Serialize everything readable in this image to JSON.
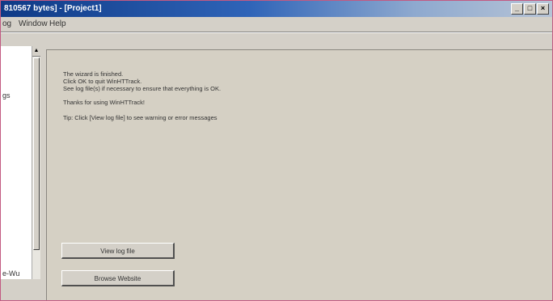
{
  "window": {
    "title": "810567 bytes] - [Project1]",
    "controls": [
      "_",
      "□",
      "×"
    ]
  },
  "menu": [
    "og",
    "Window",
    "Help"
  ],
  "left_pane": {
    "items": [
      "gs",
      "e-Wu"
    ]
  },
  "main": {
    "lines": [
      "The wizard is finished.",
      "Click OK to quit WinHTTrack.",
      "See log file(s) if necessary to ensure that everything is OK.",
      "Thanks for using WinHTTrack!",
      "Tip: Click [View log file] to see warning or error messages"
    ],
    "buttons": {
      "view_log": "View log file",
      "browse": "Browse Website"
    }
  }
}
